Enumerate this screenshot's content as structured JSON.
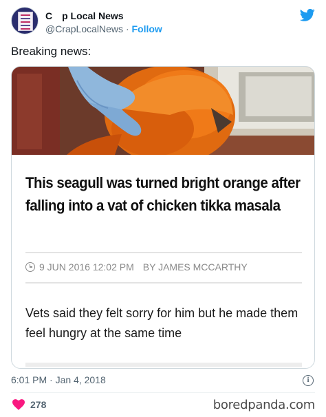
{
  "tweet": {
    "display_name": "C  p Local News",
    "handle": "@CrapLocalNews",
    "separator": "·",
    "follow_label": "Follow",
    "text": "Breaking news:",
    "timestamp": "6:01 PM · Jan 4, 2018",
    "like_count": "278",
    "info_glyph": "i"
  },
  "article": {
    "headline": "This seagull was turned bright orange after falling into a vat of chicken tikka masala",
    "date": "9 JUN 2016 12:02 PM",
    "author": "BY JAMES MCCARTHY",
    "standfirst": "Vets said they felt sorry for him but he made them feel hungry at the same time"
  },
  "watermark": "boredpanda.com",
  "icons": {
    "twitter": "twitter-bird-icon",
    "clock": "clock-icon",
    "info": "info-icon",
    "like": "heart-icon"
  },
  "colors": {
    "twitter_blue": "#1d9bf0",
    "like_pink": "#f91880",
    "text_muted": "#536471",
    "seagull_orange": "#e8650f"
  }
}
